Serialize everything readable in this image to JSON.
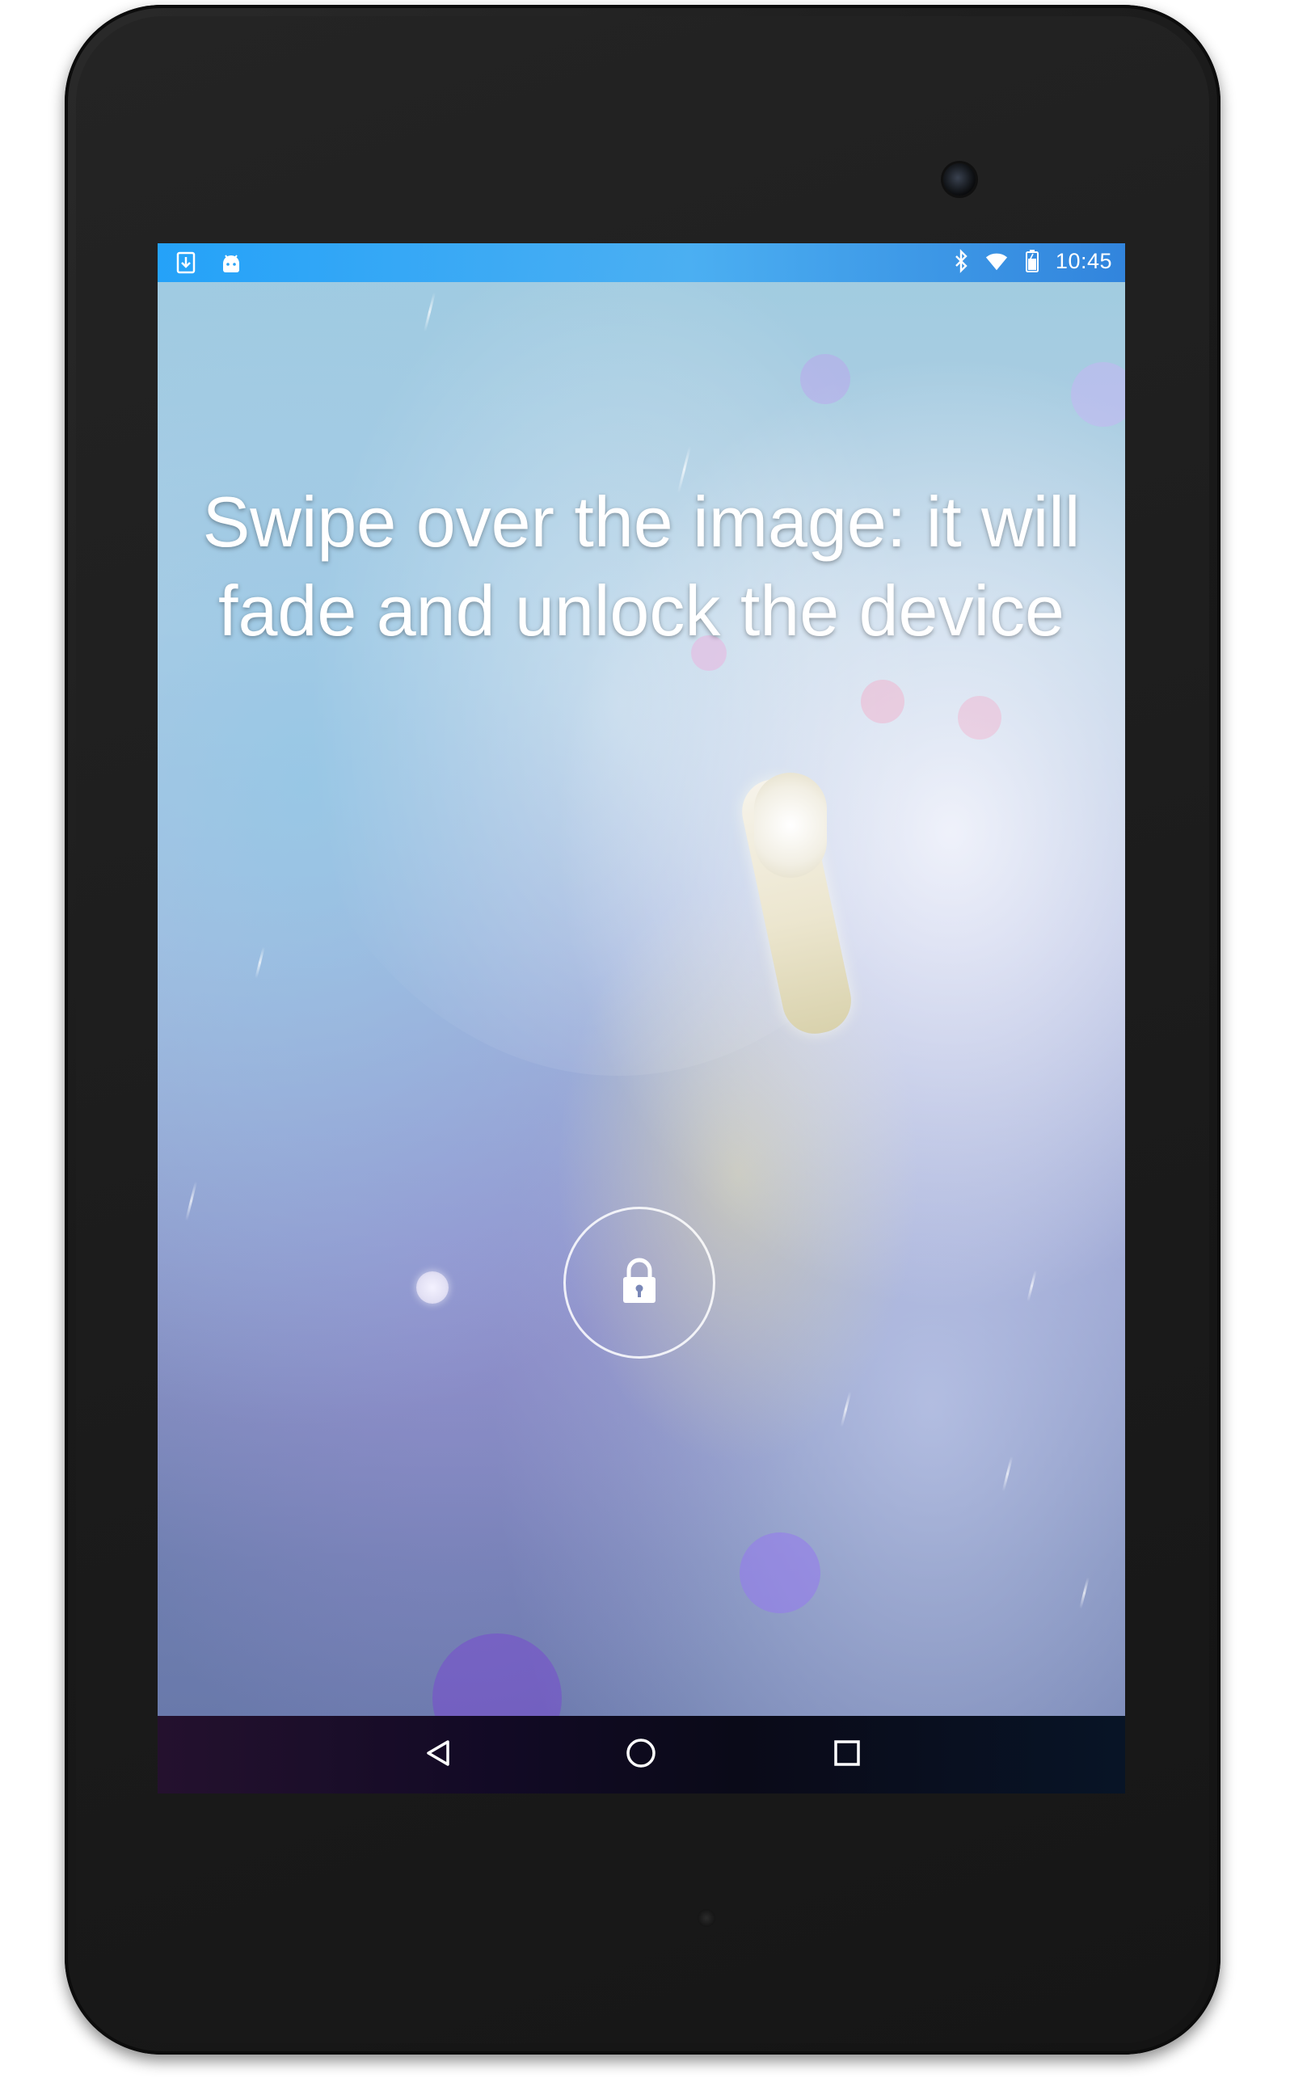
{
  "status_bar": {
    "left_icons": [
      "download-icon",
      "android-icon"
    ],
    "right_icons": [
      "bluetooth-icon",
      "wifi-icon",
      "battery-icon"
    ],
    "time": "10:45"
  },
  "lockscreen": {
    "message": "Swipe over the image: it will fade and unlock the device",
    "lock_icon": "lock-icon"
  },
  "nav_bar": {
    "buttons": [
      {
        "name": "back",
        "icon": "back-triangle-icon"
      },
      {
        "name": "home",
        "icon": "home-circle-icon"
      },
      {
        "name": "recents",
        "icon": "recents-square-icon"
      }
    ]
  },
  "colors": {
    "status_bar": "#2aa3f5",
    "nav_bar": "#0a0a18",
    "text": "#ffffff"
  }
}
